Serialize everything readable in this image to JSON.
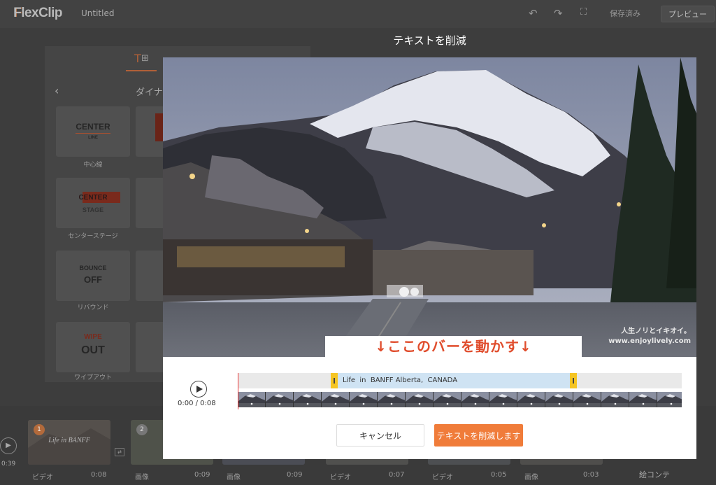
{
  "app": {
    "logo": "FlexClip",
    "doc_title": "Untitled"
  },
  "toolbar": {
    "saved_label": "保存済み",
    "preview_label": "プレビュー"
  },
  "panel": {
    "title": "ダイナ",
    "templates": [
      {
        "line1": "CENTER",
        "line2": "LINE",
        "name": "中心線"
      },
      {
        "line1": "CENTER",
        "line2": "STAGE",
        "name": "センターステージ"
      },
      {
        "line1": "BOUNCE",
        "line2": "OFF",
        "name": "リバウンド"
      },
      {
        "line1": "WIPE",
        "line2": "OUT",
        "name": "ワイプアウト"
      }
    ]
  },
  "timeline": {
    "total_time": "0:39",
    "clips": [
      {
        "type": "ビデオ",
        "duration": "0:08",
        "number": "1",
        "caption": "Life in BANFF"
      },
      {
        "type": "画像",
        "duration": "0:09",
        "number": "2"
      },
      {
        "type": "画像",
        "duration": "0:09"
      },
      {
        "type": "ビデオ",
        "duration": "0:07"
      },
      {
        "type": "ビデオ",
        "duration": "0:05"
      },
      {
        "type": "画像",
        "duration": "0:03"
      }
    ],
    "storyboard_label": "絵コンテ"
  },
  "modal": {
    "title": "テキストを削減",
    "instruction": "↓ここのバーを動かす↓",
    "watermark_line1": "人生ノリとイキオイ。",
    "watermark_line2": "www.enjoylively.com",
    "time_display": "0:00 / 0:08",
    "range_text": "Life  in  BANFF Alberta,  CANADA",
    "cancel_label": "キャンセル",
    "confirm_label": "テキストを削減します"
  }
}
